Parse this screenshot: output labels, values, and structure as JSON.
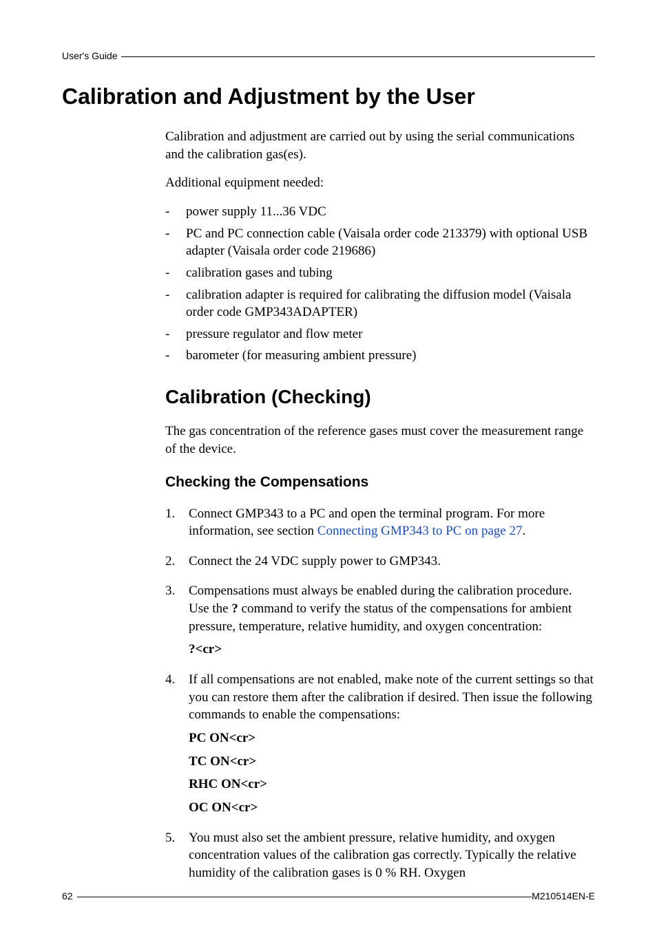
{
  "header": {
    "running": "User's Guide"
  },
  "h1": "Calibration and Adjustment by the User",
  "intro1": "Calibration and adjustment are carried out by using the serial communications and the calibration gas(es).",
  "intro2": "Additional equipment needed:",
  "equip": [
    "power supply 11...36 VDC",
    "PC and PC connection cable (Vaisala order code 213379) with optional USB adapter (Vaisala order code 219686)",
    "calibration gases and tubing",
    "calibration adapter is required for calibrating the diffusion model (Vaisala order code GMP343ADAPTER)",
    "pressure regulator and flow meter",
    "barometer (for measuring ambient pressure)"
  ],
  "h2": "Calibration (Checking)",
  "calib_para": "The gas concentration of the reference gases must cover the measurement range of the device.",
  "h3": "Checking the Compensations",
  "steps": {
    "s1a": "Connect GMP343 to a PC and open the terminal program. For more information, see section ",
    "s1link": "Connecting GMP343 to PC on page 27",
    "s1b": ".",
    "s2": "Connect the 24 VDC supply power to GMP343.",
    "s3a": "Compensations must always be enabled during the calibration procedure. Use the ",
    "s3q": "?",
    "s3b": " command to verify the status of the compensations for ambient pressure, temperature, relative humidity, and oxygen concentration:",
    "s3cmd": "?<cr>",
    "s4": "If all compensations are not enabled, make note of the current settings so that you can restore them after the calibration if desired. Then issue the following commands to enable the compensations:",
    "s4a": "PC ON<cr>",
    "s4b": "TC ON<cr>",
    "s4c": "RHC ON<cr>",
    "s4d": "OC ON<cr>",
    "s5": "You must also set the ambient pressure, relative humidity, and oxygen concentration values of the calibration gas correctly. Typically the relative humidity of the calibration gases is 0 % RH. Oxygen"
  },
  "footer": {
    "page": "62",
    "docid": "M210514EN-E"
  }
}
